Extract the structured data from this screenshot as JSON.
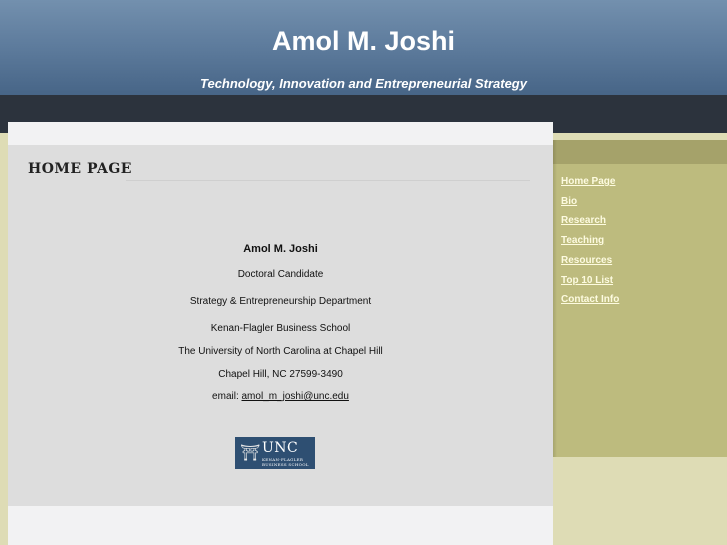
{
  "header": {
    "title": "Amol M. Joshi",
    "tagline": "Technology, Innovation and Entrepreneurial Strategy"
  },
  "content": {
    "heading": "HOME PAGE",
    "name": "Amol M. Joshi",
    "position": "Doctoral Candidate",
    "department": "Strategy & Entrepreneurship Department",
    "school": "Kenan-Flagler Business School",
    "university": "The University of North Carolina at Chapel Hill",
    "address": "Chapel Hill, NC 27599-3490",
    "email_label": "email: ",
    "email": "amol_m_joshi@unc.edu"
  },
  "logo": {
    "text": "UNC",
    "subtext_line1": "KENAN-FLAGLER",
    "subtext_line2": "BUSINESS SCHOOL"
  },
  "sidebar": {
    "items": [
      {
        "label": "Home Page"
      },
      {
        "label": "Bio"
      },
      {
        "label": "Research"
      },
      {
        "label": "Teaching"
      },
      {
        "label": "Resources"
      },
      {
        "label": "Top 10 List"
      },
      {
        "label": "Contact Info"
      }
    ]
  },
  "colors": {
    "header_top": "#7390ae",
    "header_bottom": "#476587",
    "dark_bar": "#2c333d",
    "sidebar_bg": "#bdbb7e",
    "sidebar_top": "#a5a26a",
    "page_bg": "#dedcb5",
    "logo_bg": "#2e4f72"
  }
}
